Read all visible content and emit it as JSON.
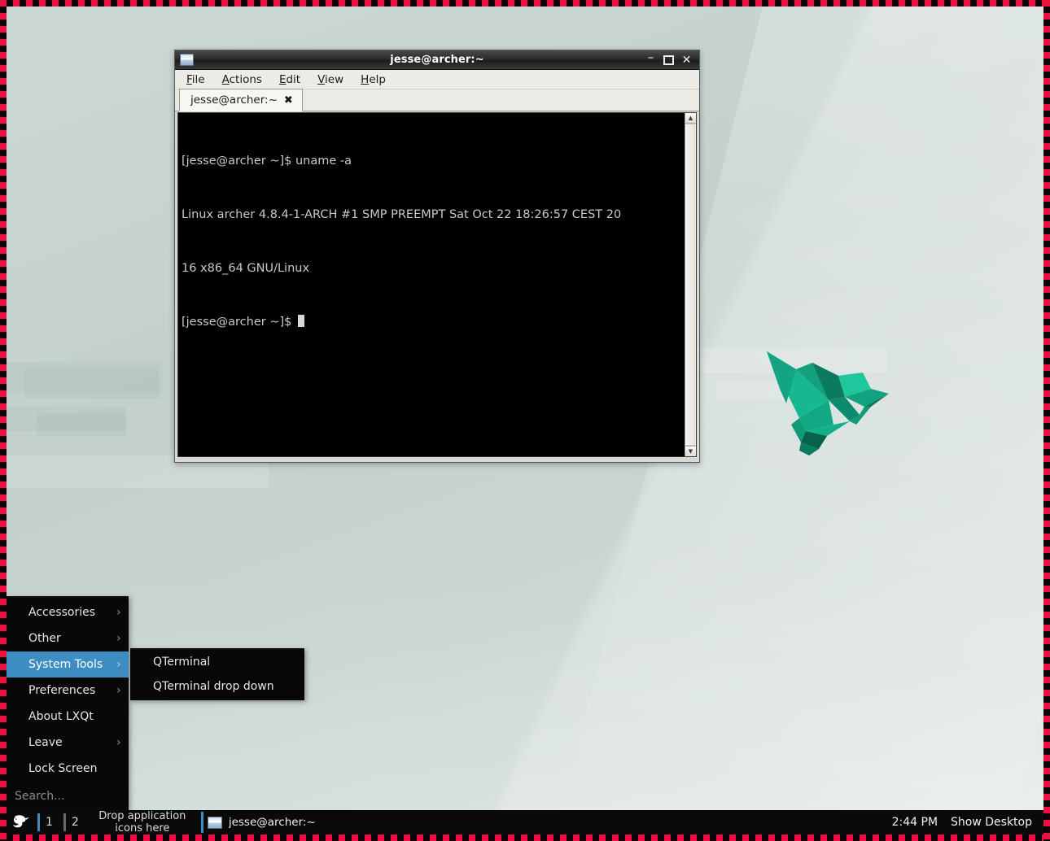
{
  "desktop": {
    "background_color": "#c6d3d0",
    "wallpaper_subject": "low-poly-origami-hummingbird",
    "bird_colors": {
      "light": "#17b891",
      "mid": "#12a883",
      "dark": "#0b7a5e",
      "darkest": "#07624b"
    },
    "border": {
      "color_a": "#e8123c",
      "color_b": "#120008"
    }
  },
  "terminal": {
    "title": "jesse@archer:~",
    "window_icon": "terminal-window-icon",
    "buttons": {
      "minimize": "minimize-icon",
      "maximize": "maximize-icon",
      "close": "close-icon"
    },
    "menubar": [
      {
        "label": "File",
        "accel": "F"
      },
      {
        "label": "Actions",
        "accel": "A"
      },
      {
        "label": "Edit",
        "accel": "E"
      },
      {
        "label": "View",
        "accel": "V"
      },
      {
        "label": "Help",
        "accel": "H"
      }
    ],
    "tabs": [
      {
        "label": "jesse@archer:~",
        "close": "✖",
        "active": true
      }
    ],
    "output_lines": [
      "[jesse@archer ~]$ uname -a",
      "Linux archer 4.8.4-1-ARCH #1 SMP PREEMPT Sat Oct 22 18:26:57 CEST 20",
      "16 x86_64 GNU/Linux",
      "[jesse@archer ~]$ "
    ],
    "scrollbar": {
      "up_arrow": "▲",
      "down_arrow": "▼"
    }
  },
  "app_menu": {
    "items": [
      {
        "label": "Accessories",
        "has_submenu": true,
        "selected": false
      },
      {
        "label": "Other",
        "has_submenu": true,
        "selected": false
      },
      {
        "label": "System Tools",
        "has_submenu": true,
        "selected": true
      },
      {
        "label": "Preferences",
        "has_submenu": true,
        "selected": false
      },
      {
        "label": "About LXQt",
        "has_submenu": false,
        "selected": false
      },
      {
        "label": "Leave",
        "has_submenu": true,
        "selected": false
      },
      {
        "label": "Lock Screen",
        "has_submenu": false,
        "selected": false
      }
    ],
    "search_placeholder": "Search...",
    "submenu_arrow": "›",
    "highlight_color": "#3d8dc2"
  },
  "sub_menu": {
    "parent": "System Tools",
    "items": [
      {
        "label": "QTerminal"
      },
      {
        "label": "QTerminal drop down"
      }
    ]
  },
  "taskbar": {
    "logo": "lxqt-bird-logo-icon",
    "workspaces": [
      {
        "label": "1",
        "active": true
      },
      {
        "label": "2",
        "active": false
      }
    ],
    "dropzone_text": "Drop application icons here",
    "windows": [
      {
        "label": "jesse@archer:~",
        "icon": "terminal-window-icon",
        "active": true
      }
    ],
    "clock": "2:44 PM",
    "show_desktop_label": "Show Desktop"
  }
}
